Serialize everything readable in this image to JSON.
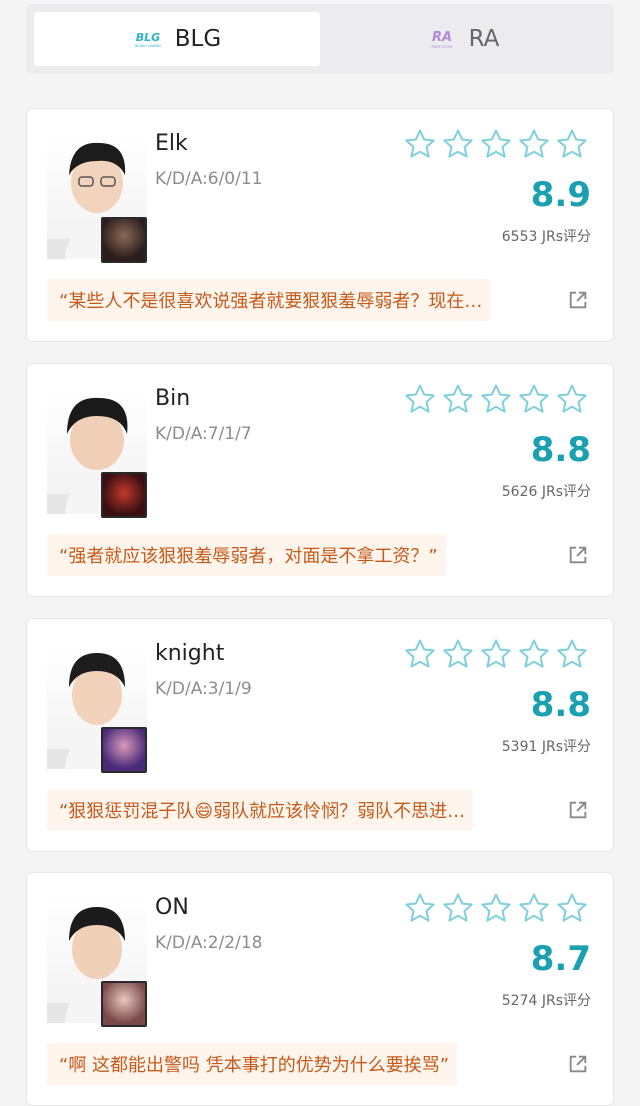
{
  "tabs": [
    {
      "label": "BLG",
      "logo_text": "BLG",
      "logo_sub": "BILIBILI GAMING",
      "active": true,
      "color": "#2ab4c8"
    },
    {
      "label": "RA",
      "logo_text": "RA",
      "logo_sub": "RARE ATOM",
      "active": false,
      "color": "#b48ad8"
    }
  ],
  "accent_color": "#1aa0b0",
  "rating_suffix": "JRs评分",
  "players": [
    {
      "name": "Elk",
      "kda": "K/D/A:6/0/11",
      "score": "8.9",
      "votes": "6553 JRs评分",
      "stars": 5,
      "quote": "“某些人不是很喜欢说强者就要狠狠羞辱弱者？现在…",
      "champion_icon": "champion-portrait-dark-armor"
    },
    {
      "name": "Bin",
      "kda": "K/D/A:7/1/7",
      "score": "8.8",
      "votes": "5626 JRs评分",
      "stars": 5,
      "quote": "“强者就应该狠狠羞辱弱者，对面是不拿工资？”",
      "champion_icon": "champion-portrait-red-demon"
    },
    {
      "name": "knight",
      "kda": "K/D/A:3/1/9",
      "score": "8.8",
      "votes": "5391 JRs评分",
      "stars": 5,
      "quote": "“狠狠惩罚混子队😄弱队就应该怜悯？弱队不思进…",
      "champion_icon": "champion-portrait-purple-mage"
    },
    {
      "name": "ON",
      "kda": "K/D/A:2/2/18",
      "score": "8.7",
      "votes": "5274 JRs评分",
      "stars": 5,
      "quote": "“啊 这都能出警吗 凭本事打的优势为什么要挨骂”",
      "champion_icon": "champion-portrait-pale-support"
    }
  ]
}
